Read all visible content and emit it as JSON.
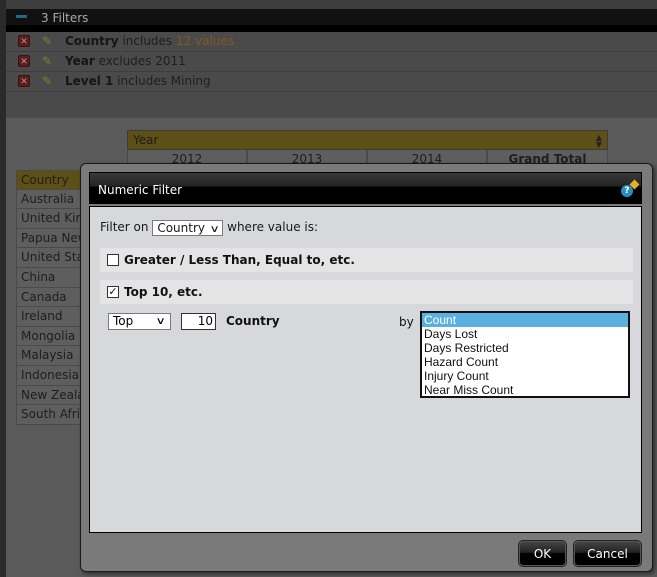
{
  "filters": {
    "header": "3 Filters",
    "items": [
      {
        "field": "Country",
        "operator": "includes",
        "value": "12 values",
        "value_highlight": true
      },
      {
        "field": "Year",
        "operator": "excludes",
        "value": "2011",
        "value_highlight": false
      },
      {
        "field": "Level 1",
        "operator": "includes",
        "value": "Mining",
        "value_highlight": false
      }
    ]
  },
  "pivot": {
    "column_field": "Year",
    "columns": [
      "2012",
      "2013",
      "2014",
      "Grand Total"
    ],
    "row_field": "Country",
    "rows": [
      "Australia",
      "United Kingdom",
      "Papua New Guinea",
      "United States",
      "China",
      "Canada",
      "Ireland",
      "Mongolia",
      "Malaysia",
      "Indonesia",
      "New Zealand",
      "South Africa"
    ]
  },
  "dialog": {
    "title": "Numeric Filter",
    "filter_on_prefix": "Filter on",
    "filter_on_value": "Country",
    "filter_on_suffix": "where value is:",
    "option_compare": {
      "label": "Greater / Less Than, Equal to, etc.",
      "checked": false
    },
    "option_top": {
      "label": "Top 10, etc.",
      "checked": true
    },
    "top_select_value": "Top",
    "top_count": "10",
    "top_field": "Country",
    "by_label": "by",
    "measures": [
      "Count",
      "Days Lost",
      "Days Restricted",
      "Hazard Count",
      "Injury Count",
      "Near Miss Count"
    ],
    "selected_measure": "Count",
    "ok_label": "OK",
    "cancel_label": "Cancel"
  }
}
